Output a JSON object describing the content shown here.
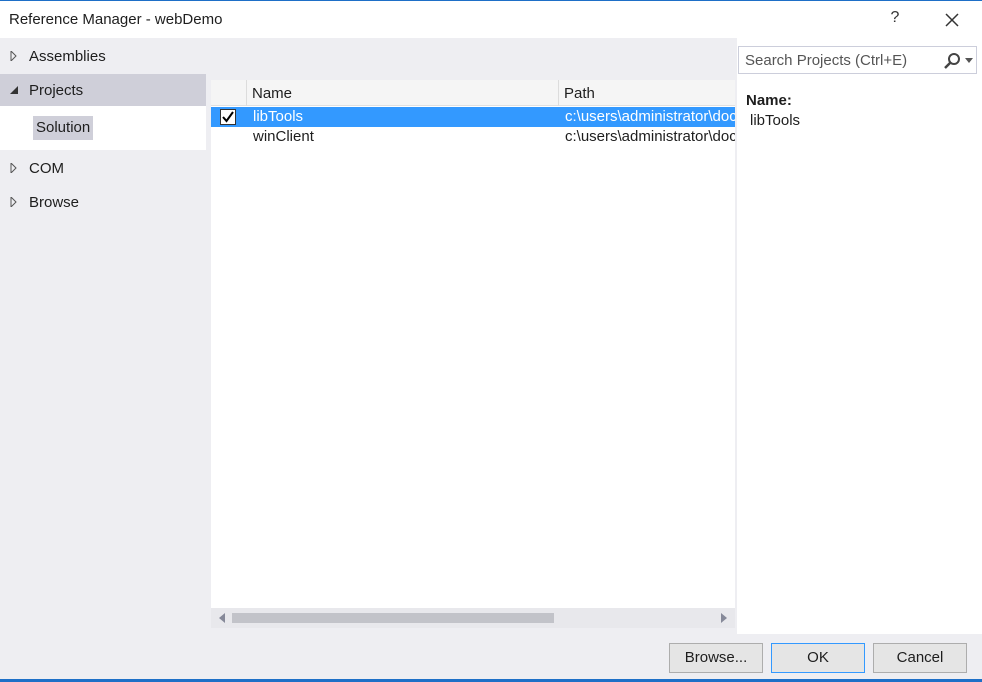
{
  "window": {
    "title": "Reference Manager - webDemo",
    "help_label": "?"
  },
  "sidebar": {
    "items": [
      {
        "label": "Assemblies"
      },
      {
        "label": "Projects"
      },
      {
        "label": "COM"
      },
      {
        "label": "Browse"
      }
    ],
    "subitem": "Solution"
  },
  "search": {
    "placeholder": "Search Projects (Ctrl+E)"
  },
  "grid": {
    "headers": [
      "Name",
      "Path"
    ],
    "rows": [
      {
        "name": "libTools",
        "path": "c:\\users\\administrator\\doc",
        "checked": true
      },
      {
        "name": "winClient",
        "path": "c:\\users\\administrator\\doc",
        "checked": false
      }
    ]
  },
  "details": {
    "label": "Name:",
    "value": "libTools"
  },
  "footer": {
    "browse": "Browse...",
    "ok": "OK",
    "cancel": "Cancel"
  },
  "colors": {
    "accent": "#1e6fc7",
    "selection": "#3399ff",
    "panel": "#eeeef2"
  },
  "icons": [
    "close-icon",
    "search-icon",
    "expand-arrow-icon",
    "collapse-arrow-icon",
    "checkmark-icon"
  ]
}
